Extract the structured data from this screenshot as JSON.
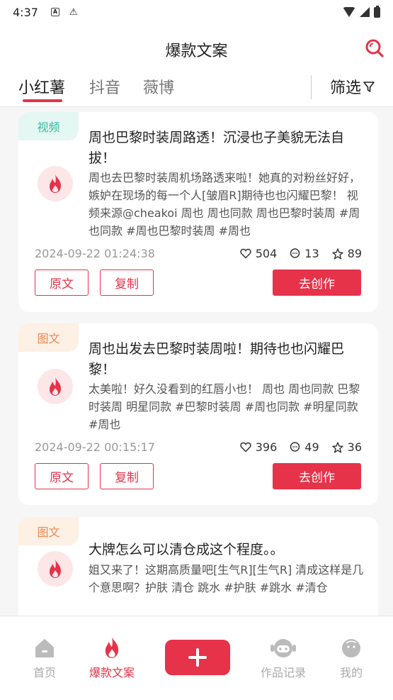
{
  "status": {
    "time": "4:37"
  },
  "header": {
    "title": "爆款文案"
  },
  "tabs": [
    {
      "label": "小红薯"
    },
    {
      "label": "抖音"
    },
    {
      "label": "薇博"
    }
  ],
  "filter_label": "筛选",
  "cards": [
    {
      "badge": "视频",
      "title": "周也巴黎时装周路透！沉浸也子美貌无法自拔！",
      "body": "周也去巴黎时装周机场路透来啦！她真的对粉丝好好，嫉妒在现场的每一个人[皱眉R]期待也也闪耀巴黎！ 视频来源@cheakoi 周也 周也同款 周也巴黎时装周 #周也同款 #周也巴黎时装周 #周也",
      "datetime": "2024-09-22 01:24:38",
      "likes": "504",
      "comments": "13",
      "stars": "89",
      "original_btn": "原文",
      "copy_btn": "复制",
      "create_btn": "去创作"
    },
    {
      "badge": "图文",
      "title": "周也出发去巴黎时装周啦！期待也也闪耀巴黎！",
      "body": "太美啦！好久没看到的红唇小也！ 周也 周也同款 巴黎时装周 明星同款 #巴黎时装周 #周也同款 #明星同款 #周也",
      "datetime": "2024-09-22 00:15:17",
      "likes": "396",
      "comments": "49",
      "stars": "36",
      "original_btn": "原文",
      "copy_btn": "复制",
      "create_btn": "去创作"
    },
    {
      "badge": "图文",
      "title": "大牌怎么可以清仓成这个程度。。",
      "body": "姐又来了！这期高质量吧[生气R][生气R] 清成这样是几个意思啊？护肤 清仓 跳水 #护肤 #跳水 #清仓"
    }
  ],
  "nav": [
    {
      "label": "首页",
      "icon": "home-icon"
    },
    {
      "label": "爆款文案",
      "icon": "fire-icon"
    },
    {
      "label": "作品记录",
      "icon": "robot-icon"
    },
    {
      "label": "我的",
      "icon": "profile-icon"
    }
  ],
  "colors": {
    "accent": "#e6334a",
    "video_badge": "#36b99c",
    "image_badge": "#f1884f"
  }
}
